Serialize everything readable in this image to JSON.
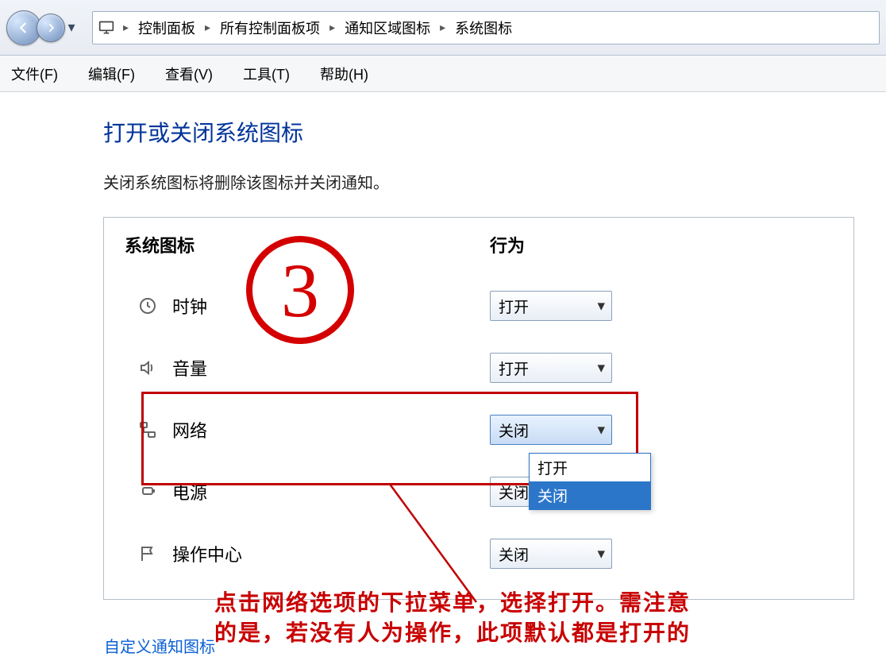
{
  "titlebar": {
    "breadcrumb": [
      "控制面板",
      "所有控制面板项",
      "通知区域图标",
      "系统图标"
    ]
  },
  "menubar": {
    "items": [
      "文件(F)",
      "编辑(F)",
      "查看(V)",
      "工具(T)",
      "帮助(H)"
    ]
  },
  "page": {
    "title": "打开或关闭系统图标",
    "description": "关闭系统图标将删除该图标并关闭通知。"
  },
  "settings": {
    "header_label": "系统图标",
    "header_action": "行为",
    "rows": [
      {
        "label": "时钟",
        "value": "打开"
      },
      {
        "label": "音量",
        "value": "打开"
      },
      {
        "label": "网络",
        "value": "关闭"
      },
      {
        "label": "电源",
        "value": "关闭"
      },
      {
        "label": "操作中心",
        "value": "关闭"
      }
    ],
    "dropdown_options": [
      "打开",
      "关闭"
    ],
    "dropdown_selected": "关闭"
  },
  "annotation": {
    "badge": "3",
    "text_line1": "点击网络选项的下拉菜单，选择打开。需注意",
    "text_line2": "的是，若没有人为操作，此项默认都是打开的"
  },
  "bottom_link": "自定义通知图标"
}
